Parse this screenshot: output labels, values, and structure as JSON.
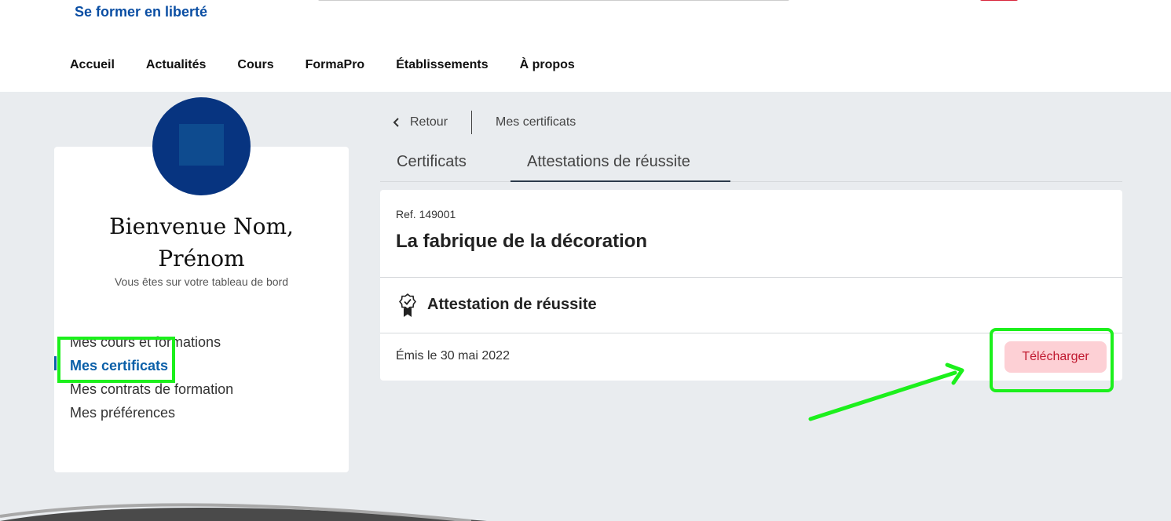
{
  "header": {
    "brand": "Se former en liberté",
    "nav": [
      "Accueil",
      "Actualités",
      "Cours",
      "FormaPro",
      "Établissements",
      "À propos"
    ]
  },
  "sidebar": {
    "welcome_line1": "Bienvenue Nom,",
    "welcome_line2": "Prénom",
    "subtitle": "Vous êtes sur votre tableau de bord",
    "items": [
      {
        "label": "Mes cours et formations"
      },
      {
        "label": "Mes certificats"
      },
      {
        "label": "Mes contrats de formation"
      },
      {
        "label": "Mes préférences"
      }
    ]
  },
  "breadcrumb": {
    "back": "Retour",
    "current": "Mes certificats"
  },
  "tabs": [
    {
      "label": "Certificats"
    },
    {
      "label": "Attestations de réussite"
    }
  ],
  "card": {
    "ref": "Ref. 149001",
    "title": "La fabrique de la décoration",
    "attestation_title": "Attestation de réussite",
    "issued": "Émis le 30 mai 2022",
    "download_label": "Télécharger"
  },
  "colors": {
    "brand_blue": "#0a4ea3",
    "avatar_blue": "#073480",
    "highlight_green": "#1cf01c",
    "download_bg": "#fdd0d5",
    "download_text": "#c0182f"
  }
}
